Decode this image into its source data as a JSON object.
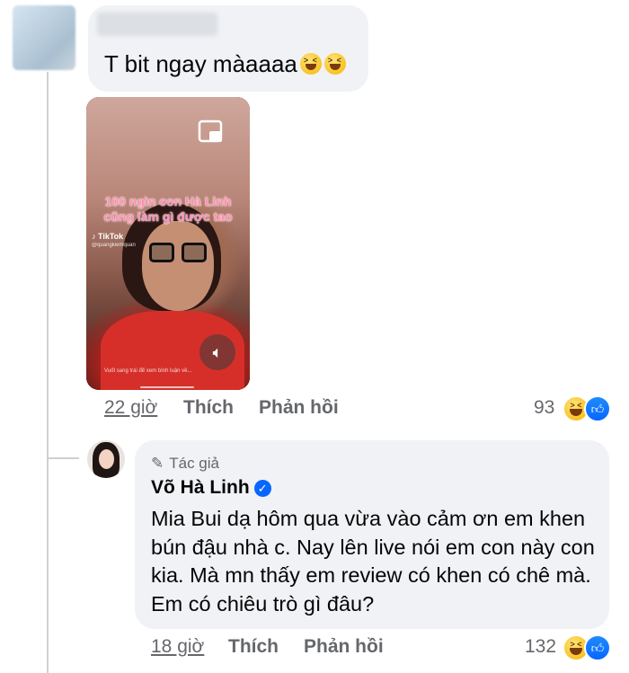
{
  "comment": {
    "text": "T bit ngay màaaaa",
    "emojis": [
      "laughing-face",
      "laughing-face"
    ],
    "video": {
      "overlay_line1": "100 ngìn con Hà Linh",
      "overlay_line2": "cũng làm gì được tao",
      "tiktok_label": "TikTok",
      "tiktok_user": "@quangkiemquan",
      "swipe_hint": "Vuốt sang trái để xem bình luận về..."
    },
    "actions": {
      "time": "22 giờ",
      "like": "Thích",
      "reply": "Phản hồi"
    },
    "reaction_count": "93"
  },
  "reply": {
    "author_badge": "Tác giả",
    "name": "Võ Hà Linh",
    "text": "Mia Bui dạ hôm qua vừa vào cảm ơn em khen bún đậu nhà c. Nay lên live nói em con này con kia. Mà mn thấy em review có khen có chê mà. Em có chiêu trò gì đâu?",
    "actions": {
      "time": "18 giờ",
      "like": "Thích",
      "reply": "Phản hồi"
    },
    "reaction_count": "132"
  },
  "colors": {
    "bubble": "#f0f2f5",
    "secondary_text": "#65676b",
    "verified_blue": "#0866ff"
  }
}
